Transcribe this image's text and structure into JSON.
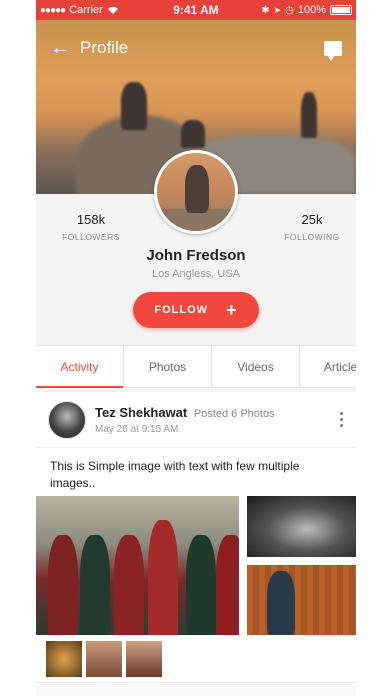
{
  "status_bar": {
    "signal_dots": "●●●●●",
    "carrier": "Carrier",
    "wifi_icon": "wifi-icon",
    "time": "9:41 AM",
    "battery": "100%"
  },
  "header": {
    "back_icon": "←",
    "title": "Profile",
    "chat_icon": "chat-icon"
  },
  "profile": {
    "name": "John Fredson",
    "location": "Los Angless, USA",
    "followers_count": "158k",
    "followers_label": "FOLLOWERS",
    "following_count": "25k",
    "following_label": "FOLLOWING",
    "follow_button": "FOLLOW",
    "follow_plus": "+"
  },
  "tabs": [
    {
      "label": "Activity",
      "active": true
    },
    {
      "label": "Photos",
      "active": false
    },
    {
      "label": "Videos",
      "active": false
    },
    {
      "label": "Articles",
      "active": false
    }
  ],
  "post": {
    "author": "Tez Shekhawat",
    "action": "Posted 6 Photos",
    "time": "May 26 at 9:15 AM",
    "text": "This is Simple image with text with few multiple images.."
  },
  "colors": {
    "accent": "#f1473d",
    "status_bar": "#e8413a"
  }
}
